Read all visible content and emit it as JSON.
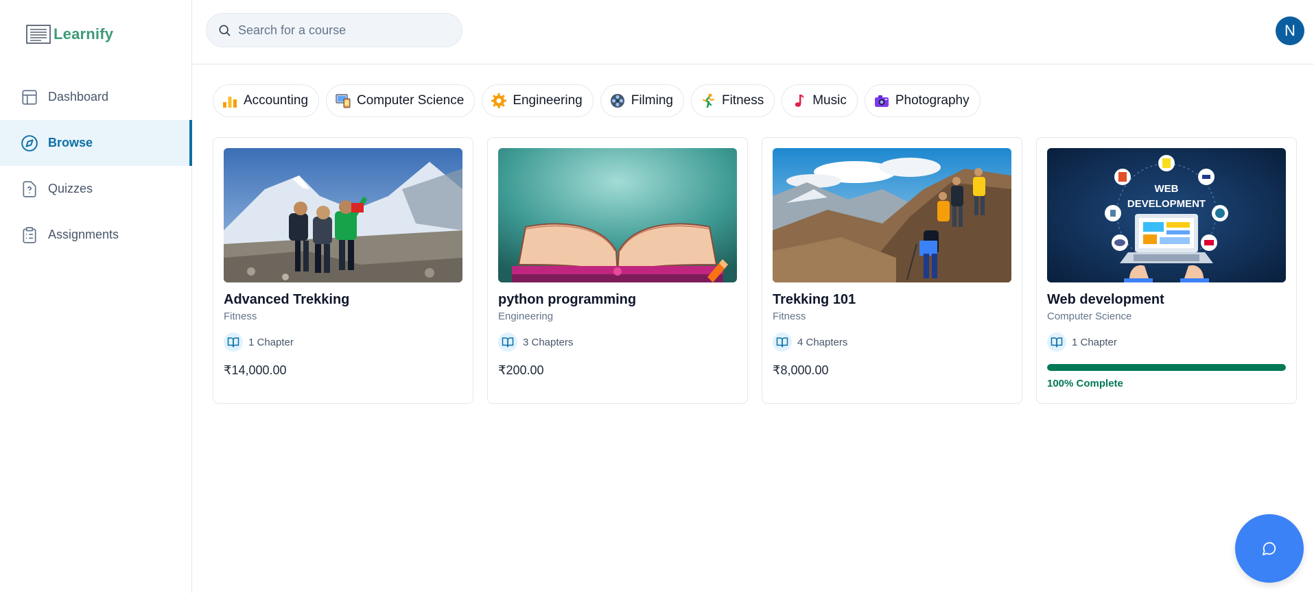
{
  "app": {
    "name": "Learnify"
  },
  "sidebar": {
    "items": [
      {
        "label": "Dashboard",
        "icon": "layout-icon",
        "active": false
      },
      {
        "label": "Browse",
        "icon": "compass-icon",
        "active": true
      },
      {
        "label": "Quizzes",
        "icon": "file-question-icon",
        "active": false
      },
      {
        "label": "Assignments",
        "icon": "clipboard-list-icon",
        "active": false
      }
    ]
  },
  "header": {
    "search_placeholder": "Search for a course",
    "avatar_initial": "N"
  },
  "categories": [
    {
      "label": "Accounting",
      "icon": "bar-chart-emoji-icon"
    },
    {
      "label": "Computer Science",
      "icon": "devices-emoji-icon"
    },
    {
      "label": "Engineering",
      "icon": "gear-emoji-icon"
    },
    {
      "label": "Filming",
      "icon": "film-reel-emoji-icon"
    },
    {
      "label": "Fitness",
      "icon": "runner-emoji-icon"
    },
    {
      "label": "Music",
      "icon": "music-note-emoji-icon"
    },
    {
      "label": "Photography",
      "icon": "camera-emoji-icon"
    }
  ],
  "courses": [
    {
      "title": "Advanced Trekking",
      "category": "Fitness",
      "chapters": "1 Chapter",
      "price": "₹14,000.00",
      "image": "trekkers-mountain-photo"
    },
    {
      "title": "python programming",
      "category": "Engineering",
      "chapters": "3 Chapters",
      "price": "₹200.00",
      "image": "open-book-photo"
    },
    {
      "title": "Trekking 101",
      "category": "Fitness",
      "chapters": "4 Chapters",
      "price": "₹8,000.00",
      "image": "hikers-ridge-photo"
    },
    {
      "title": "Web development",
      "category": "Computer Science",
      "chapters": "1 Chapter",
      "progress": 100,
      "progress_label": "100% Complete",
      "image": "web-development-illustration",
      "image_text": [
        "WEB",
        "DEVELOPMENT"
      ]
    }
  ],
  "colors": {
    "brand": "#3d9a78",
    "active_nav": "#0b6fa4",
    "progress": "#047857",
    "fab": "#3b82f6",
    "avatar": "#0b5fa0"
  },
  "chat_button": {
    "icon": "message-circle-icon"
  }
}
